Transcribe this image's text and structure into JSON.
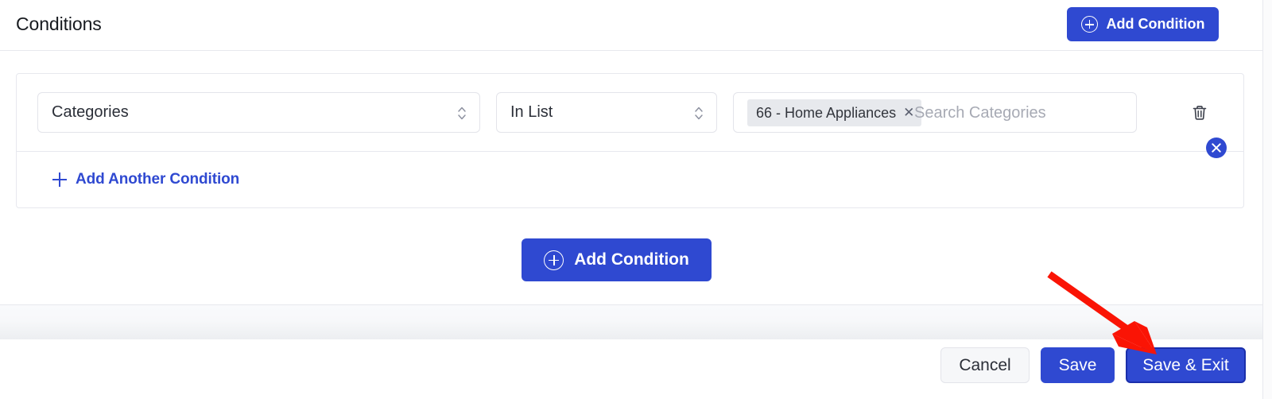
{
  "header": {
    "title": "Conditions",
    "add_condition_label": "Add Condition",
    "add_condition_icon": "plus-circle-icon"
  },
  "panel": {
    "close_icon": "close-circle-icon",
    "condition": {
      "field_value": "Categories",
      "field_stepper_icon": "chevron-up-down-icon",
      "operator_value": "In List",
      "operator_stepper_icon": "chevron-up-down-icon",
      "tags": [
        {
          "label": "66 - Home Appliances",
          "remove_icon": "close-x-icon"
        }
      ],
      "search_placeholder": "Search Categories",
      "search_value": "",
      "delete_icon": "trash-icon"
    },
    "add_another_label": "Add Another Condition",
    "add_another_icon": "plus-icon"
  },
  "main": {
    "add_condition_label": "Add Condition",
    "add_condition_icon": "plus-circle-icon"
  },
  "footer": {
    "cancel_label": "Cancel",
    "save_label": "Save",
    "save_exit_label": "Save & Exit"
  },
  "annotation": {
    "type": "arrow",
    "color": "#fa1405",
    "points_to": "save-exit-button"
  },
  "colors": {
    "primary_blue": "#2f49d1",
    "link_blue": "#2f49d1",
    "border": "#e7e8ee",
    "chip_bg": "#e7e9ed",
    "text": "#2b2f38",
    "placeholder": "#a7aab4",
    "annotation_red": "#fa1405"
  }
}
